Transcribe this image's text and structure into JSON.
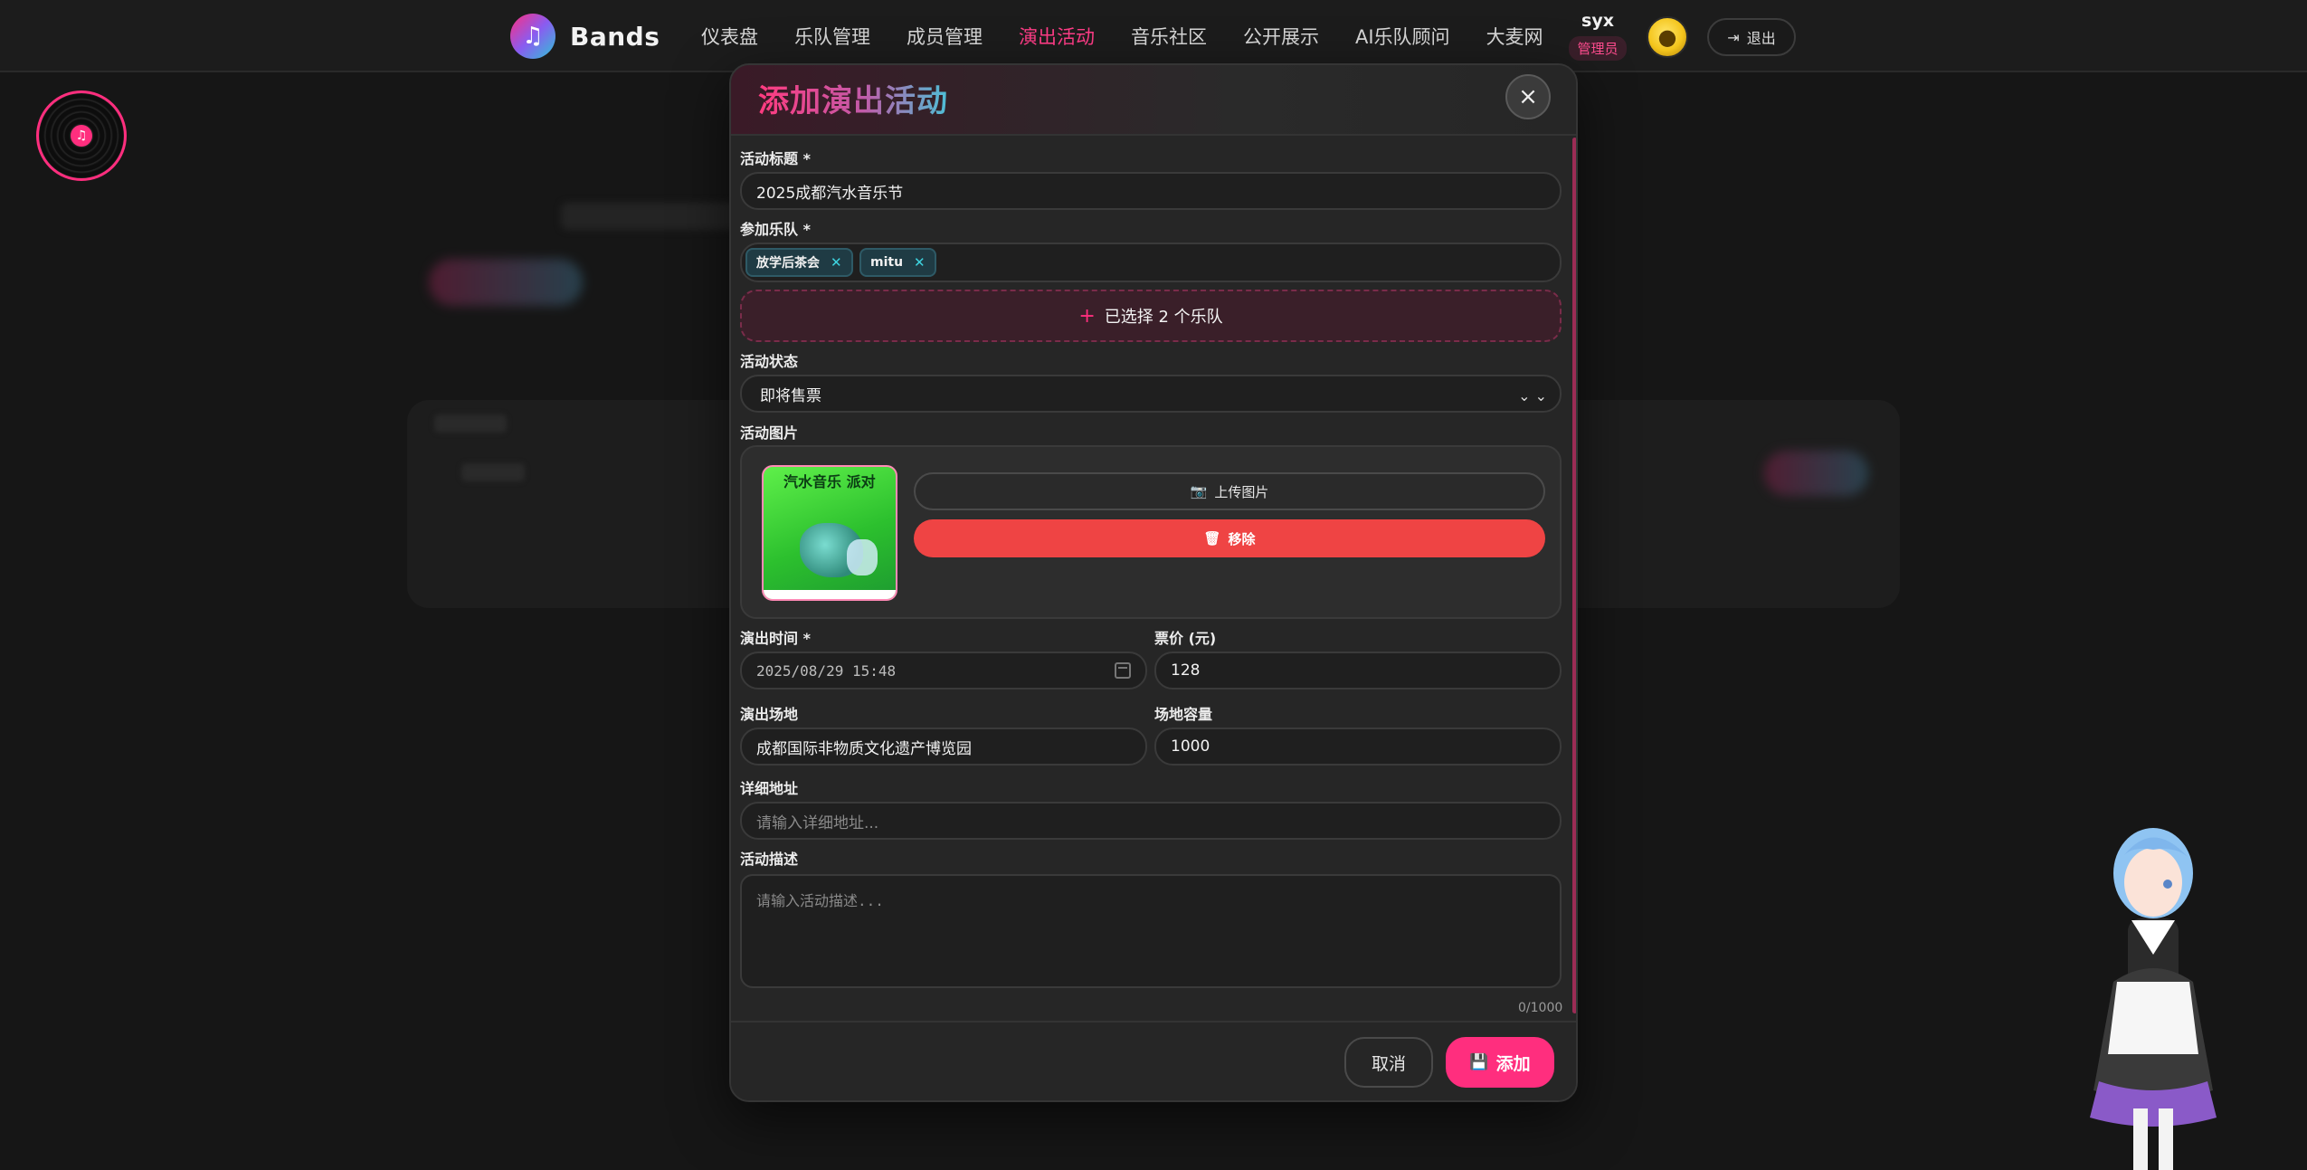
{
  "brand": {
    "name": "Bands",
    "logo_icon": "music-note-icon"
  },
  "nav": {
    "items": [
      "仪表盘",
      "乐队管理",
      "成员管理",
      "演出活动",
      "音乐社区",
      "公开展示",
      "AI乐队顾问",
      "大麦网"
    ],
    "active": "演出活动"
  },
  "user": {
    "name": "syx",
    "role": "管理员",
    "logout_label": "退出"
  },
  "modal": {
    "title": "添加演出活动",
    "fields": {
      "title_label": "活动标题 *",
      "title_value": "2025成都汽水音乐节",
      "bands_label": "参加乐队 *",
      "bands": [
        "放学后茶会",
        "mitu"
      ],
      "bands_select_label": "已选择 2 个乐队",
      "status_label": "活动状态",
      "status_value": "即将售票",
      "image_label": "活动图片",
      "poster_text": "汽水音乐 派对",
      "upload_label": "上传图片",
      "remove_label": "移除",
      "time_label": "演出时间 *",
      "time_value": "2025/08/29 15:48",
      "price_label": "票价 (元)",
      "price_value": "128",
      "venue_label": "演出场地",
      "venue_value": "成都国际非物质文化遗产博览园",
      "capacity_label": "场地容量",
      "capacity_value": "1000",
      "address_label": "详细地址",
      "address_placeholder": "请输入详细地址...",
      "desc_label": "活动描述",
      "desc_placeholder": "请输入活动描述...",
      "desc_counter": "0/1000"
    },
    "footer": {
      "cancel_label": "取消",
      "add_label": "添加"
    }
  },
  "colors": {
    "accent": "#ff2e7e",
    "danger": "#ef4444",
    "chip": "#1f3b44",
    "background": "#161616"
  }
}
